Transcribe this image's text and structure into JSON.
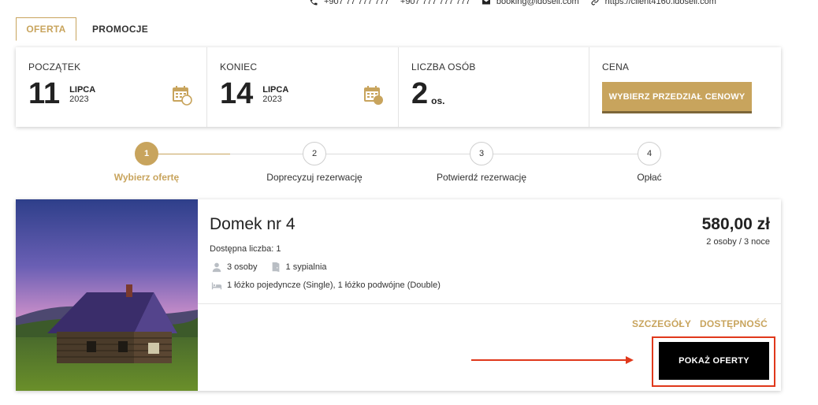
{
  "topbar": {
    "phone1": "+907 77 777 777",
    "phone2": "+907 777 777 777",
    "email": "booking@idosell.com",
    "website": "https://client4160.idosell.com"
  },
  "tabs": [
    {
      "label": "OFERTA",
      "active": true
    },
    {
      "label": "PROMOCJE",
      "active": false
    }
  ],
  "search": {
    "start": {
      "label": "POCZĄTEK",
      "day": "11",
      "month": "LIPCA",
      "year": "2023"
    },
    "end": {
      "label": "KONIEC",
      "day": "14",
      "month": "LIPCA",
      "year": "2023"
    },
    "persons": {
      "label": "LICZBA OSÓB",
      "count": "2",
      "unit": "os."
    },
    "price": {
      "label": "CENA",
      "button": "WYBIERZ PRZEDZIAŁ CENOWY"
    }
  },
  "steps": [
    {
      "number": "1",
      "label": "Wybierz ofertę",
      "active": true
    },
    {
      "number": "2",
      "label": "Doprecyzuj rezerwację",
      "active": false
    },
    {
      "number": "3",
      "label": "Potwierdź rezerwację",
      "active": false
    },
    {
      "number": "4",
      "label": "Opłać",
      "active": false
    }
  ],
  "offer": {
    "title": "Domek nr 4",
    "price": "580,00 zł",
    "price_detail": "2 osoby / 3 noce",
    "availability": "Dostępna liczba: 1",
    "persons": "3 osoby",
    "bedrooms": "1 sypialnia",
    "beds": "1 łóżko pojedyncze (Single), 1 łóżko podwójne (Double)",
    "details_link": "SZCZEGÓŁY",
    "availability_link": "DOSTĘPNOŚĆ",
    "show_offers_button": "POKAŻ OFERTY"
  },
  "colors": {
    "accent": "#c8a45d",
    "highlight": "#e0381b",
    "button_dark": "#000000"
  },
  "icons": [
    "phone-icon",
    "mail-icon",
    "link-icon",
    "calendar-icon",
    "person-icon",
    "door-icon",
    "bed-icon",
    "arrow-icon"
  ]
}
